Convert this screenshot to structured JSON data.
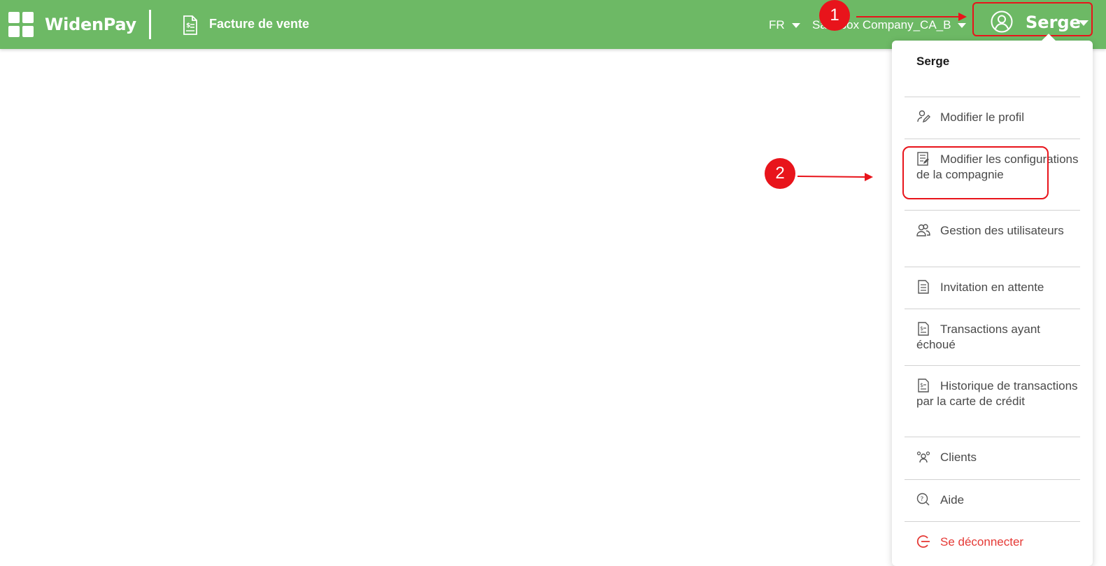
{
  "topbar": {
    "brand": "WidenPay",
    "page_title": "Facture de vente",
    "language": "FR",
    "company": "Sandbox Company_CA_B",
    "user_name": "Serge"
  },
  "annotations": {
    "callout1": "1",
    "callout2": "2"
  },
  "colors": {
    "topbar": "#6db965",
    "accent_red": "#e8141b",
    "logout_text": "#e53935"
  },
  "dropdown": {
    "username": "Serge",
    "items": [
      {
        "label": "Modifier le profil",
        "icon": "user-edit-icon"
      },
      {
        "label": "Modifier les configurations de la compagnie",
        "icon": "building-edit-icon"
      },
      {
        "label": "Gestion des utilisateurs",
        "icon": "users-icon"
      },
      {
        "label": "Invitation en attente",
        "icon": "invitation-doc-icon"
      },
      {
        "label": "Transactions ayant échoué",
        "icon": "failed-transactions-icon"
      },
      {
        "label": "Historique de transactions par la carte de crédit",
        "icon": "credit-history-icon"
      },
      {
        "label": "Clients",
        "icon": "clients-icon"
      },
      {
        "label": "Aide",
        "icon": "help-icon"
      },
      {
        "label": "Se déconnecter",
        "icon": "logout-icon"
      }
    ]
  }
}
